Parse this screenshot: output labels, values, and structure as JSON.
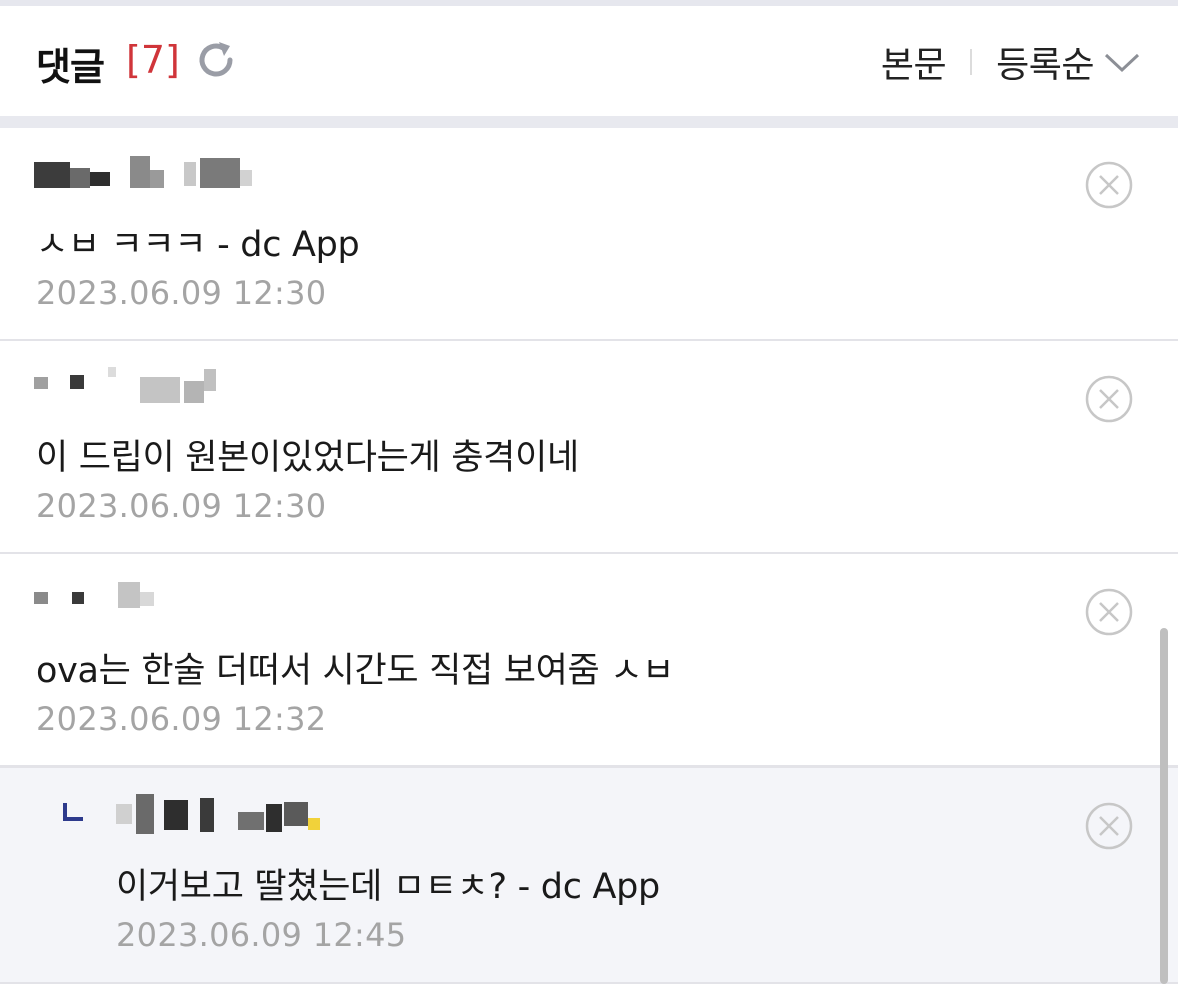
{
  "header": {
    "title": "댓글",
    "count": "[7]",
    "refresh_icon": "refresh-icon",
    "view_body_label": "본문",
    "sort_label": "등록순",
    "sort_icon": "chevron-down-icon"
  },
  "comments": [
    {
      "text": "ㅅㅂ ㅋㅋㅋ - dc App",
      "date": "2023.06.09 12:30",
      "is_reply": false
    },
    {
      "text": "이 드립이 원본이있었다는게 충격이네",
      "date": "2023.06.09 12:30",
      "is_reply": false
    },
    {
      "text": "ova는 한술 더떠서 시간도 직접 보여줌 ㅅㅂ",
      "date": "2023.06.09 12:32",
      "is_reply": false
    },
    {
      "text": "이거보고 딸쳤는데 ㅁㅌㅊ? - dc App",
      "date": "2023.06.09 12:45",
      "is_reply": true
    }
  ],
  "icons": {
    "delete": "close-circle-icon",
    "reply": "reply-arrow-icon"
  },
  "colors": {
    "count": "#d0353a",
    "date": "#a4a4a4",
    "reply_bg": "#f4f5f9",
    "reply_mark": "#2d3a8c"
  }
}
